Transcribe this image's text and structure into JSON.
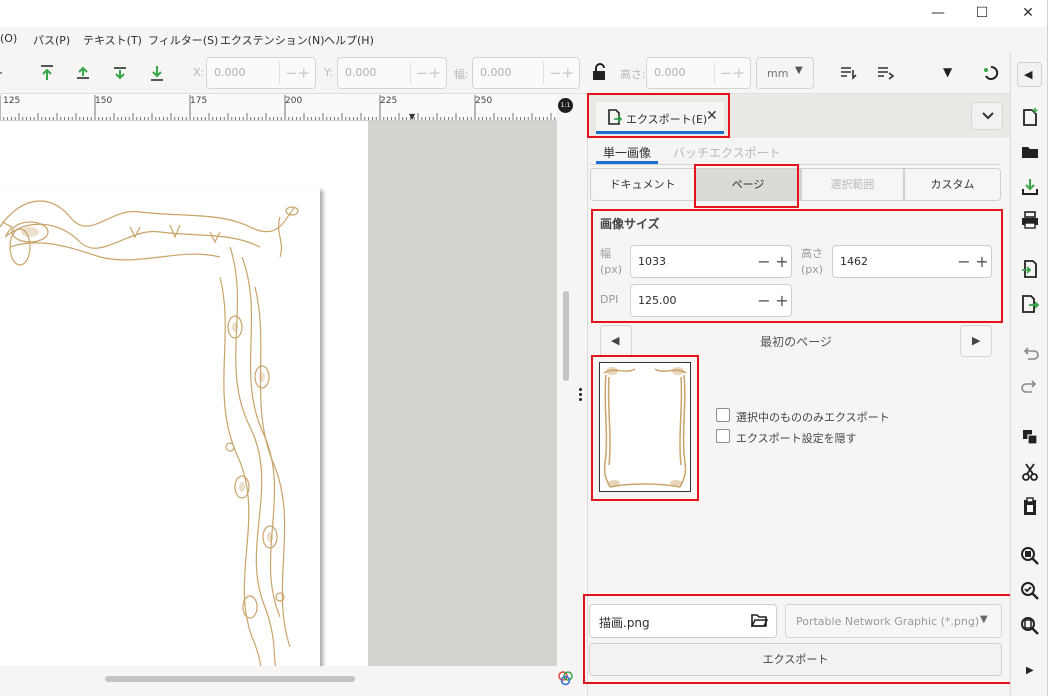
{
  "window": {
    "minimize": "—",
    "maximize": "☐",
    "close": "✕"
  },
  "menu": [
    "(O)",
    "パス(P)",
    "テキスト(T)",
    "フィルター(S)",
    "エクステンション(N)",
    "ヘルプ(H)"
  ],
  "toolbar": {
    "x_label": "X:",
    "x_value": "0.000",
    "y_label": "Y:",
    "y_value": "0.000",
    "w_label": "幅:",
    "w_value": "0.000",
    "h_label": "高さ:",
    "h_value": "0.000",
    "unit": "mm"
  },
  "ruler": {
    "ticks": [
      "125",
      "150",
      "175",
      "200",
      "225",
      "250"
    ],
    "corner_badge": "1:1"
  },
  "export_panel": {
    "tab_label": "エクスポート(E)",
    "subtabs": {
      "single": "単一画像",
      "batch": "バッチエクスポート"
    },
    "modes": {
      "document": "ドキュメント",
      "page": "ページ",
      "selection": "選択範囲",
      "custom": "カスタム"
    },
    "image_size": {
      "title": "画像サイズ",
      "width_label": "幅",
      "width_unit": "(px)",
      "width_value": "1033",
      "height_label": "高さ",
      "height_unit": "(px)",
      "height_value": "1462",
      "dpi_label": "DPI",
      "dpi_value": "125.00"
    },
    "page_nav": {
      "label": "最初のページ"
    },
    "options": {
      "selected_only": "選択中のもののみエクスポート",
      "hide_settings": "エクスポート設定を隠す"
    },
    "filename": "描画.png",
    "format": "Portable Network Graphic (*.png)",
    "export_button": "エクスポート"
  },
  "colors": {
    "accent": "#1c6fd1",
    "highlight": "#e0141c",
    "artwork": "#c9a46a"
  }
}
